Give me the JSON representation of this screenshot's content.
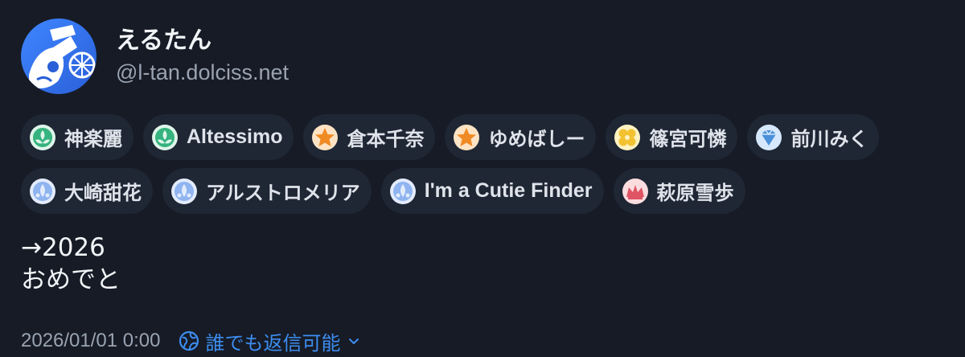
{
  "user": {
    "display_name": "えるたん",
    "handle": "@l-tan.dolciss.net"
  },
  "badges": [
    {
      "label": "神楽麗",
      "icon": "green-leaf-badge-icon",
      "color": "#36b37e"
    },
    {
      "label": "Altessimo",
      "icon": "green-leaf-badge-icon",
      "color": "#36b37e"
    },
    {
      "label": "倉本千奈",
      "icon": "orange-star-badge-icon",
      "color": "#f08a24"
    },
    {
      "label": "ゆめばしー",
      "icon": "orange-star-badge-icon",
      "color": "#f08a24"
    },
    {
      "label": "篠宮可憐",
      "icon": "yellow-clover-badge-icon",
      "color": "#f2c230"
    },
    {
      "label": "前川みく",
      "icon": "blue-diamond-badge-icon",
      "color": "#4a90d9"
    },
    {
      "label": "大崎甜花",
      "icon": "light-blue-drop-badge-icon",
      "color": "#8fb4f0"
    },
    {
      "label": "アルストロメリア",
      "icon": "light-blue-drop-badge-icon",
      "color": "#8fb4f0"
    },
    {
      "label": "I'm a Cutie Finder",
      "icon": "light-blue-drop-badge-icon",
      "color": "#8fb4f0"
    },
    {
      "label": "萩原雪歩",
      "icon": "red-crown-badge-icon",
      "color": "#e05564"
    }
  ],
  "content": {
    "line1": "→2026",
    "line2": "おめでと"
  },
  "footer": {
    "timestamp": "2026/01/01 0:00",
    "visibility": "誰でも返信可能",
    "visibility_icon": "globe-icon",
    "dropdown_icon": "chevron-down-icon"
  },
  "colors": {
    "background": "#161b26",
    "badge_background": "#1f2634",
    "accent": "#3d8df0",
    "muted_text": "#9aa3b1"
  }
}
